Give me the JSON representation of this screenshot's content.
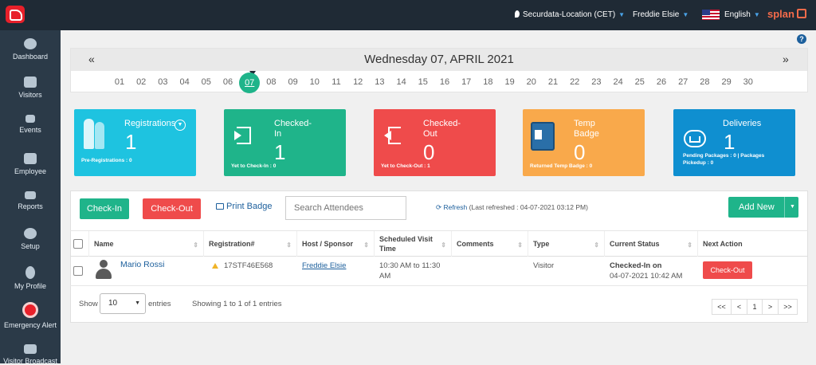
{
  "topbar": {
    "location": "Securdata-Location (CET)",
    "user": "Freddie Elsie",
    "language": "English",
    "brand": "splan",
    "location_icon": "map-pin-icon",
    "flag_icon": "us-flag-icon"
  },
  "sidebar": {
    "items": [
      {
        "label": "Dashboard",
        "icon": "dashboard-icon"
      },
      {
        "label": "Visitors",
        "icon": "visitors-icon"
      },
      {
        "label": "Events",
        "icon": "events-icon"
      },
      {
        "label": "Employee",
        "icon": "employee-icon"
      },
      {
        "label": "Reports",
        "icon": "reports-icon"
      },
      {
        "label": "Setup",
        "icon": "setup-icon"
      },
      {
        "label": "My Profile",
        "icon": "profile-icon"
      },
      {
        "label": "Emergency Alert",
        "icon": "alert-icon"
      },
      {
        "label": "Visitor Broadcast",
        "icon": "broadcast-icon"
      }
    ]
  },
  "calendar": {
    "title": "Wednesday 07, APRIL 2021",
    "prev": "«",
    "next": "»",
    "days": [
      "01",
      "02",
      "03",
      "04",
      "05",
      "06",
      "07",
      "08",
      "09",
      "10",
      "11",
      "12",
      "13",
      "14",
      "15",
      "16",
      "17",
      "18",
      "19",
      "20",
      "21",
      "22",
      "23",
      "24",
      "25",
      "26",
      "27",
      "28",
      "29",
      "30"
    ],
    "selected": "07"
  },
  "cards": {
    "registrations": {
      "title": "Registrations",
      "value": "1",
      "sub": "Pre-Registrations : 0",
      "color": "#1ec3e0"
    },
    "checked_in": {
      "title1": "Checked-",
      "title2": "In",
      "value": "1",
      "sub": "Yet to Check-In : 0",
      "color": "#1fb48a"
    },
    "checked_out": {
      "title1": "Checked-",
      "title2": "Out",
      "value": "0",
      "sub": "Yet to Check-Out : 1",
      "color": "#ef4b4b"
    },
    "temp_badge": {
      "title1": "Temp",
      "title2": "Badge",
      "value": "0",
      "sub": "Returned Temp Badge : 0",
      "color": "#f9a94b"
    },
    "deliveries": {
      "title": "Deliveries",
      "value": "1",
      "sub1": "Pending Packages : 0 | Packages",
      "sub2": "Pickedup : 0",
      "color": "#0f8fd0"
    }
  },
  "toolbar": {
    "checkin": "Check-In",
    "checkout": "Check-Out",
    "print_badge": "Print Badge",
    "search_placeholder": "Search Attendees",
    "refresh": "Refresh",
    "last_refreshed": "(Last refreshed : 04-07-2021 03:12 PM)",
    "add_new": "Add New"
  },
  "table": {
    "headers": {
      "name": "Name",
      "registration": "Registration#",
      "host": "Host / Sponsor",
      "scheduled1": "Scheduled Visit",
      "scheduled2": "Time",
      "comments": "Comments",
      "type": "Type",
      "status": "Current Status",
      "next": "Next Action"
    },
    "rows": [
      {
        "name": "Mario Rossi",
        "registration": "17STF46E568",
        "host": "Freddie Elsie",
        "time1": "10:30 AM to 11:30",
        "time2": "AM",
        "comments": "",
        "type": "Visitor",
        "status1": "Checked-In on",
        "status2": "04-07-2021 10:42 AM",
        "action": "Check-Out"
      }
    ]
  },
  "footer": {
    "show": "Show",
    "entries_value": "10",
    "entries": "entries",
    "info": "Showing 1 to 1 of 1 entries",
    "pages": [
      "<<",
      "<",
      "1",
      ">",
      ">>"
    ]
  },
  "colors": {
    "topbar": "#1f2a35",
    "sidebar": "#2b3a48",
    "green": "#1fb48a",
    "red": "#ef4b4b",
    "accent": "#f56b4a"
  }
}
